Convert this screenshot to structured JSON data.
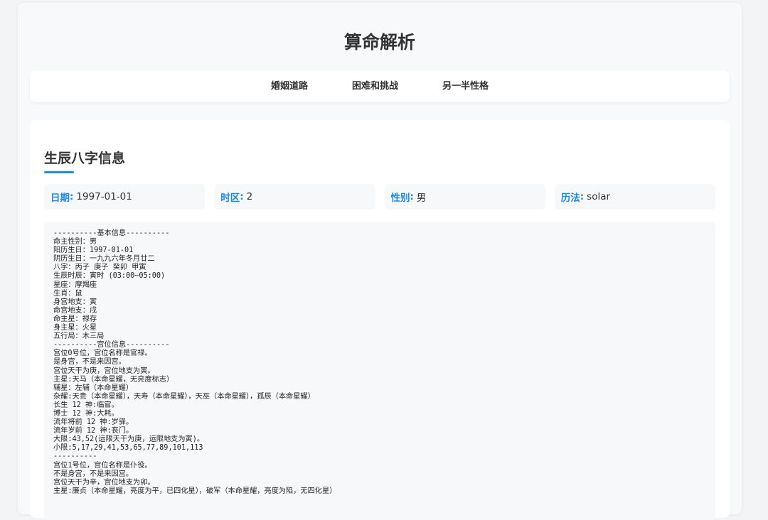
{
  "header": {
    "title": "算命解析"
  },
  "nav": {
    "items": [
      {
        "label": "婚姻道路"
      },
      {
        "label": "困难和挑战"
      },
      {
        "label": "另一半性格"
      }
    ]
  },
  "section": {
    "title": "生辰八字信息"
  },
  "info": {
    "date_label": "日期",
    "date_value": "1997-01-01",
    "hour_label": "时区",
    "hour_value": "2",
    "gender_label": "性别",
    "gender_value": "男",
    "calendar_label": "历法",
    "calendar_value": "solar"
  },
  "result": {
    "lines": [
      "----------基本信息----------",
      "命主性别：男",
      "阳历生日：1997-01-01",
      "阴历生日：一九九六年冬月廿二",
      "八字：丙子 庚子 癸卯 甲寅",
      "生辰时辰：寅时 (03:00~05:00)",
      "星座：摩羯座",
      "生肖：鼠",
      "身宫地支：寅",
      "命宫地支：戌",
      "命主星：禄存",
      "身主星：火星",
      "五行局：木三局",
      "----------宫位信息----------",
      "宫位0号位，宫位名称是官禄。",
      "是身宫，不是来因宫。",
      "宫位天干为庚，宫位地支为寅。",
      "主星:天马（本命星耀，无亮度标志）",
      "辅星：左辅（本命星耀）",
      "杂耀:天贵（本命星耀），天寿（本命星耀），天巫（本命星耀），孤辰（本命星耀）",
      "长生 12 神:临官。",
      "博士 12 神:大耗。",
      "流年将前 12 神:岁驿。",
      "流年岁前 12 神:丧门。",
      "大限:43,52(运限天干为庚，运限地支为寅)。",
      "小限:5,17,29,41,53,65,77,89,101,113",
      "----------",
      "宫位1号位，宫位名称是仆役。",
      "不是身宫，不是来因宫。",
      "宫位天干为辛，宫位地支为卯。",
      "主星:廉贞（本命星耀，亮度为平，已四化星），破军（本命星耀，亮度为陷，无四化星）"
    ]
  }
}
